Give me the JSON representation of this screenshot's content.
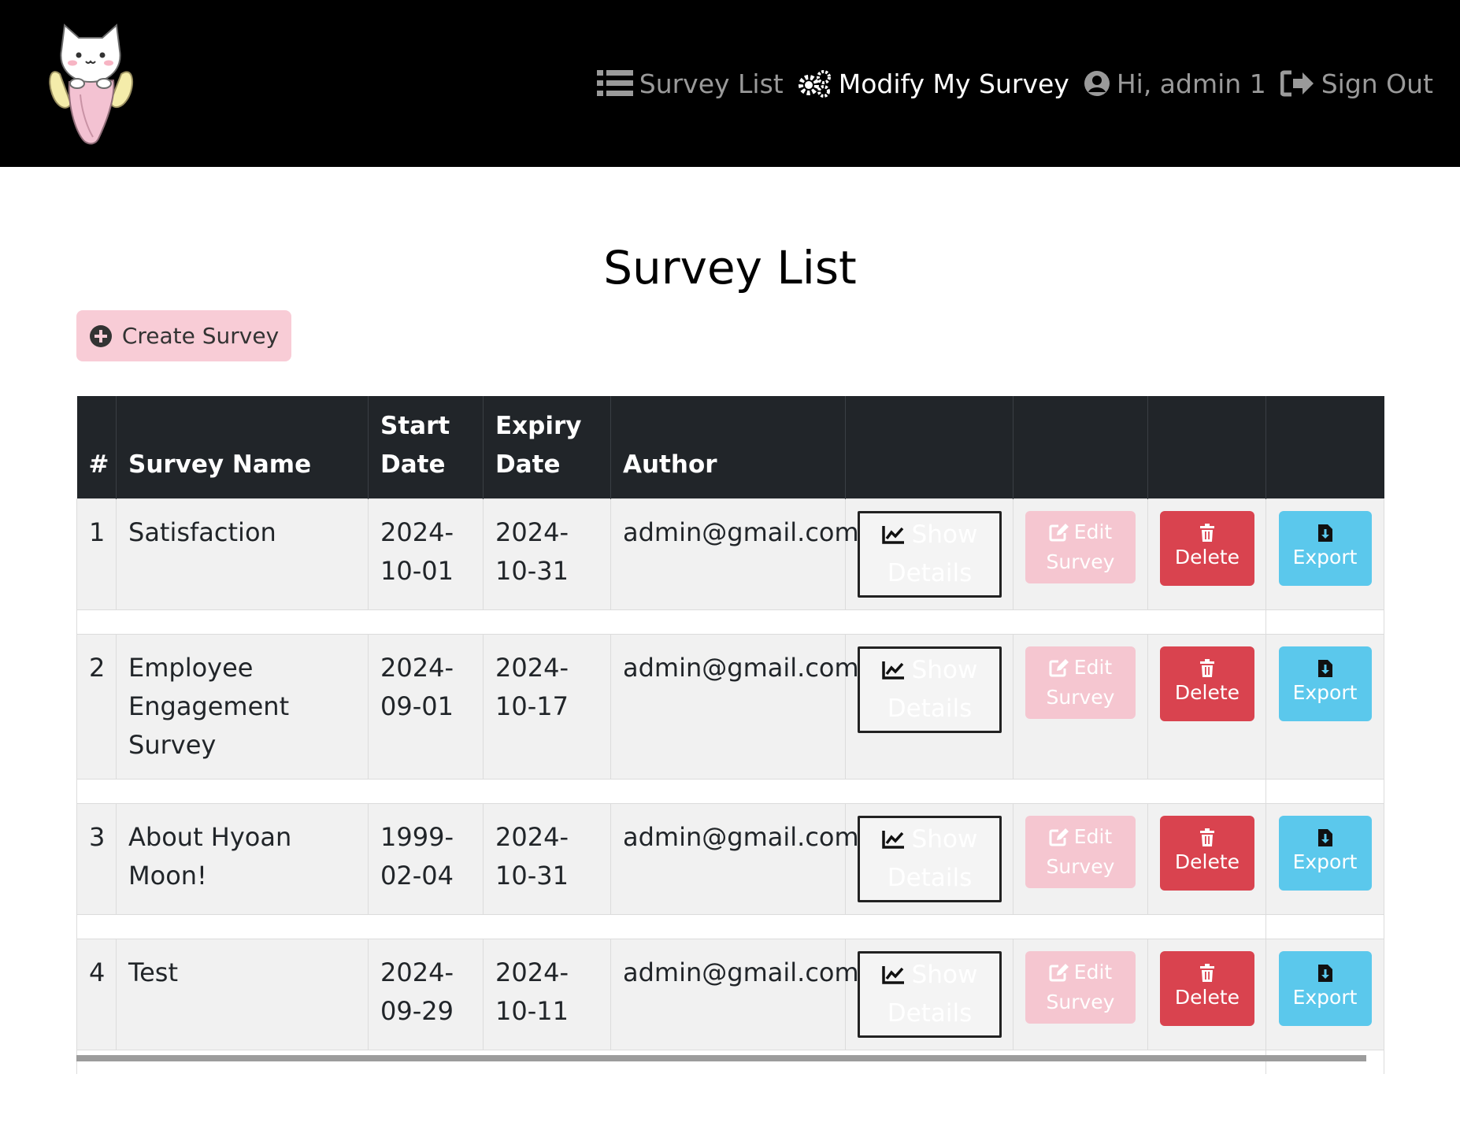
{
  "nav": {
    "survey_list": "Survey List",
    "modify_my_survey": "Modify My Survey",
    "greeting": "Hi, admin 1",
    "sign_out": "Sign Out"
  },
  "page": {
    "title": "Survey List",
    "create_button": "Create Survey"
  },
  "table": {
    "headers": {
      "index": "#",
      "name": "Survey Name",
      "start": "Start Date",
      "expiry": "Expiry Date",
      "author": "Author"
    },
    "rows": [
      {
        "index": "1",
        "name": "Satisfaction",
        "start": "2024-10-01",
        "expiry": "2024-10-31",
        "author": "admin@gmail.com"
      },
      {
        "index": "2",
        "name": "Employee Engagement Survey",
        "start": "2024-09-01",
        "expiry": "2024-10-17",
        "author": "admin@gmail.com"
      },
      {
        "index": "3",
        "name": "About Hyoan Moon!",
        "start": "1999-02-04",
        "expiry": "2024-10-31",
        "author": "admin@gmail.com"
      },
      {
        "index": "4",
        "name": "Test",
        "start": "2024-09-29",
        "expiry": "2024-10-11",
        "author": "admin@gmail.com"
      }
    ],
    "actions": {
      "show_line1": "Show",
      "show_line2": "Details",
      "edit_line1": "Edit",
      "edit_line2": "Survey",
      "delete": "Delete",
      "export": "Export"
    }
  },
  "colors": {
    "navbar": "#000000",
    "create_button": "#f8ccd6",
    "table_header": "#212529",
    "edit": "#f5c6d0",
    "delete": "#d9434f",
    "export": "#5bc8ec"
  },
  "icons": {
    "logo": "banana-cat-logo",
    "survey_list": "list-icon",
    "modify": "gears-icon",
    "user": "user-circle-icon",
    "sign_out": "sign-out-icon",
    "create": "plus-circle-icon",
    "show": "chart-line-icon",
    "edit": "edit-icon",
    "delete": "trash-icon",
    "export": "file-download-icon"
  }
}
